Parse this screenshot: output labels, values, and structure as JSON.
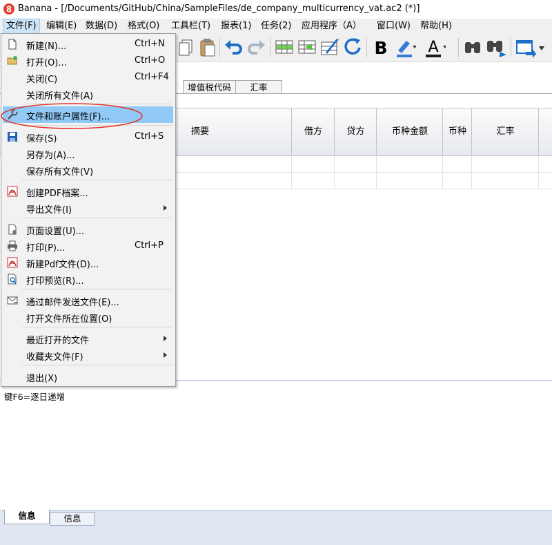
{
  "window": {
    "title": "Banana - [/Documents/GitHub/China/SampleFiles/de_company_multicurrency_vat.ac2 (*)]"
  },
  "menubar": {
    "items": [
      {
        "id": "file",
        "label": "文件(F)"
      },
      {
        "id": "edit",
        "label": "编辑(E)"
      },
      {
        "id": "data",
        "label": "数据(D)"
      },
      {
        "id": "format",
        "label": "格式(O)"
      },
      {
        "id": "toolbar",
        "label": "工具栏(T)"
      },
      {
        "id": "reports",
        "label": "报表(1)"
      },
      {
        "id": "tasks",
        "label": "任务(2)"
      },
      {
        "id": "apps",
        "label": "应用程序（A）"
      },
      {
        "id": "window",
        "label": "窗口(W)"
      },
      {
        "id": "help",
        "label": "帮助(H)"
      }
    ]
  },
  "toolbar": {
    "icons": [
      "copy-icon",
      "paste-icon",
      "undo-icon",
      "redo-icon",
      "insert-row-icon",
      "add-row-icon",
      "edit-cell-icon",
      "refresh-icon",
      "bold-icon",
      "highlight-pen-icon",
      "font-color-icon",
      "binoculars-icon",
      "binoculars-next-icon",
      "window-arrange-icon"
    ],
    "bold_glyph": "B",
    "font_color_glyph": "A",
    "colors": {
      "accent": "#1e6fc7",
      "highlight": "#3a7bd5",
      "font_color_bar": "#1a1a1a"
    }
  },
  "tabs": [
    {
      "label": "增值税代码"
    },
    {
      "label": "汇率"
    }
  ],
  "grid": {
    "columns": [
      "摘要",
      "借方",
      "贷方",
      "币种金额",
      "币种",
      "汇率"
    ]
  },
  "info_panel": {
    "text": "键F6=逐日递增"
  },
  "bottom_tabs": [
    {
      "label": "信息",
      "active": true
    },
    {
      "label": "信息",
      "active": false
    }
  ],
  "file_menu": {
    "items": [
      {
        "label": "新建(N)...",
        "shortcut": "Ctrl+N",
        "icon": "new-file-icon"
      },
      {
        "label": "打开(O)...",
        "shortcut": "Ctrl+O",
        "icon": "open-folder-icon"
      },
      {
        "label": "关闭(C)",
        "shortcut": "Ctrl+F4",
        "icon": ""
      },
      {
        "label": "关闭所有文件(A)",
        "shortcut": "",
        "icon": ""
      },
      {
        "label": "文件和账户属性(F)...",
        "shortcut": "",
        "icon": "wrench-icon",
        "highlighted": true
      },
      {
        "label": "保存(S)",
        "shortcut": "Ctrl+S",
        "icon": "save-icon"
      },
      {
        "label": "另存为(A)...",
        "shortcut": "",
        "icon": ""
      },
      {
        "label": "保存所有文件(V)",
        "shortcut": "",
        "icon": ""
      },
      {
        "label": "创建PDF档案...",
        "shortcut": "",
        "icon": "pdf-icon"
      },
      {
        "label": "导出文件(I)",
        "shortcut": "",
        "icon": "",
        "submenu": true
      },
      {
        "label": "页面设置(U)...",
        "shortcut": "",
        "icon": "page-setup-icon"
      },
      {
        "label": "打印(P)...",
        "shortcut": "Ctrl+P",
        "icon": "printer-icon"
      },
      {
        "label": "新建Pdf文件(D)...",
        "shortcut": "",
        "icon": "pdf-icon"
      },
      {
        "label": "打印预览(R)...",
        "shortcut": "",
        "icon": "print-preview-icon"
      },
      {
        "label": "通过邮件发送文件(E)...",
        "shortcut": "",
        "icon": "email-icon"
      },
      {
        "label": "打开文件所在位置(O)",
        "shortcut": "",
        "icon": ""
      },
      {
        "label": "最近打开的文件",
        "shortcut": "",
        "icon": "",
        "submenu": true
      },
      {
        "label": "收藏夹文件(F)",
        "shortcut": "",
        "icon": "",
        "submenu": true
      },
      {
        "label": "退出(X)",
        "shortcut": "",
        "icon": ""
      }
    ]
  }
}
